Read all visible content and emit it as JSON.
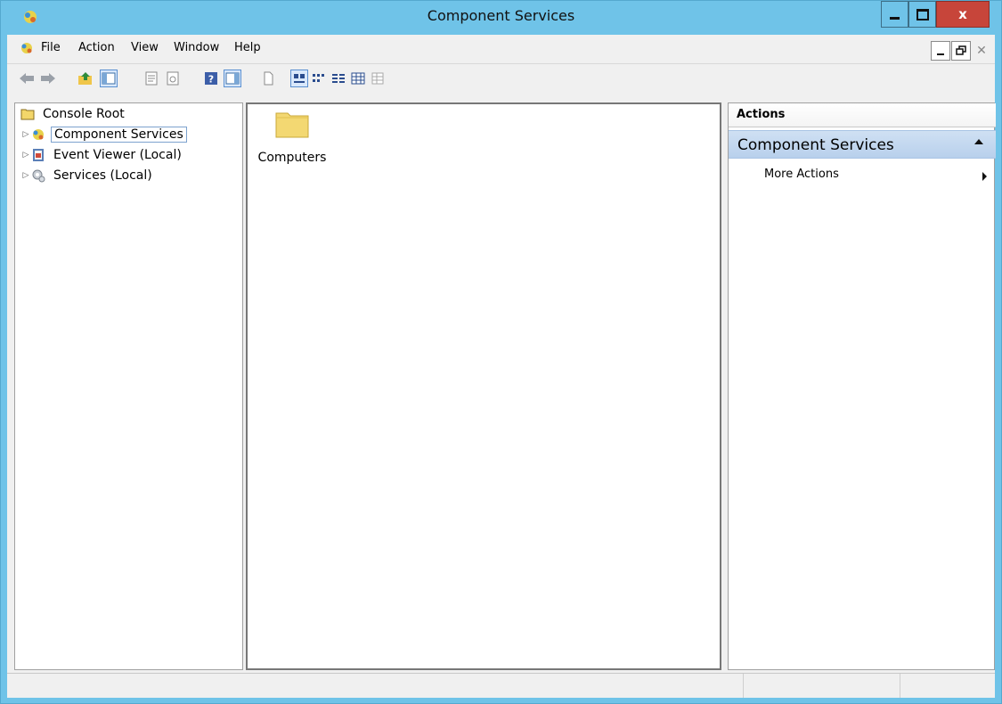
{
  "window": {
    "title": "Component Services",
    "close_glyph": "x"
  },
  "menu": {
    "items": [
      "File",
      "Action",
      "View",
      "Window",
      "Help"
    ]
  },
  "toolbar": {
    "buttons": [
      "back-icon",
      "forward-icon",
      "up-folder-icon",
      "show-hide-console-tree-icon",
      "properties-icon",
      "refresh-icon",
      "help-icon",
      "show-hide-action-pane-icon",
      "export-list-icon",
      "large-icons-icon",
      "small-icons-icon",
      "list-view-icon",
      "detail-view-icon",
      "other-view-icon"
    ]
  },
  "tree": {
    "root_label": "Console Root",
    "items": [
      {
        "label": "Component Services",
        "icon": "component-services-icon",
        "selected": true
      },
      {
        "label": "Event Viewer (Local)",
        "icon": "event-viewer-icon",
        "selected": false
      },
      {
        "label": "Services (Local)",
        "icon": "services-gear-icon",
        "selected": false
      }
    ]
  },
  "content": {
    "items": [
      {
        "label": "Computers",
        "icon": "folder-icon"
      }
    ]
  },
  "actions": {
    "header": "Actions",
    "group_title": "Component Services",
    "items": [
      {
        "label": "More Actions"
      }
    ]
  },
  "colors": {
    "titlebar": "#6fc3e8",
    "close_button": "#c7453a",
    "selection_border": "#7da2ce",
    "action_group_bg": "#cfe0f3"
  }
}
